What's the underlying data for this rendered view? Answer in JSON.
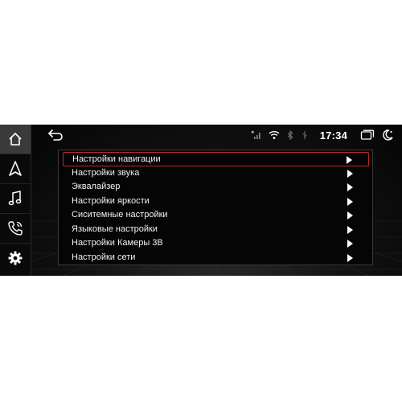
{
  "status": {
    "time": "17:34"
  },
  "sidebar": {
    "items": [
      {
        "icon": "home-icon"
      },
      {
        "icon": "navigation-icon"
      },
      {
        "icon": "music-icon"
      },
      {
        "icon": "phone-icon"
      },
      {
        "icon": "gear-icon"
      }
    ]
  },
  "menu": {
    "selected_index": 0,
    "accent_color": "#c0272d",
    "items": [
      {
        "label": "Настройки навигации"
      },
      {
        "label": "Настройки звука"
      },
      {
        "label": "Эквалайзер"
      },
      {
        "label": "Настройки яркости"
      },
      {
        "label": "Сиситемные настройки"
      },
      {
        "label": "Языковые настройки"
      },
      {
        "label": "Настройки Камеры 3В"
      },
      {
        "label": "Настройки сети"
      }
    ]
  }
}
